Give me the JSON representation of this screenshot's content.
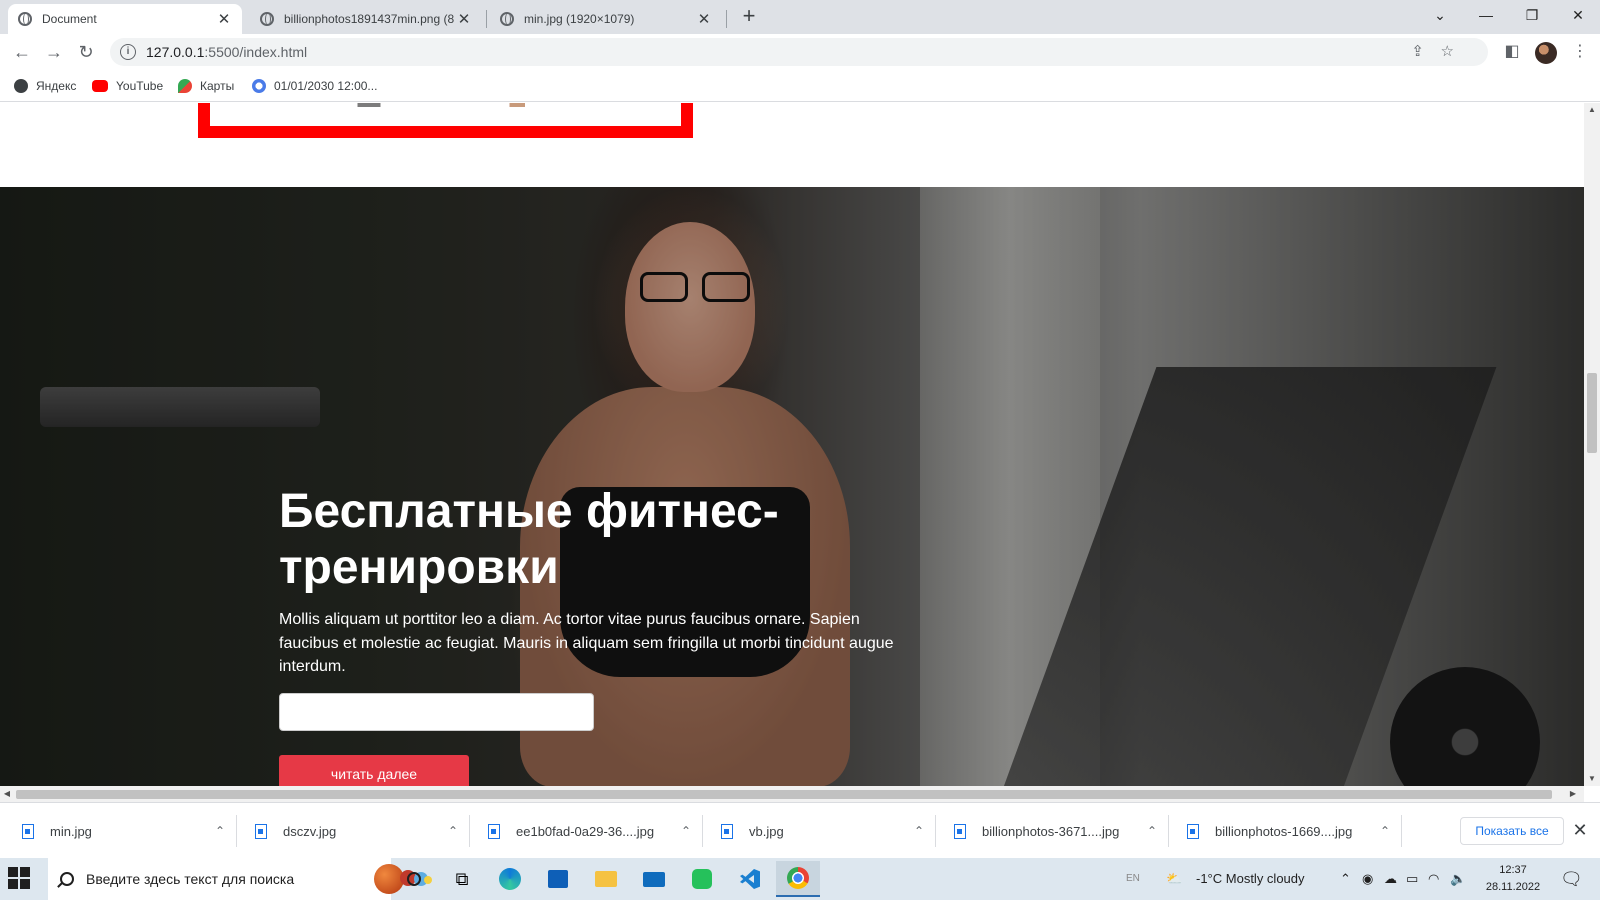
{
  "browser": {
    "tabs": [
      {
        "title": "Document",
        "active": true
      },
      {
        "title": "billionphotos1891437min.png (8",
        "active": false
      },
      {
        "title": "min.jpg (1920×1079)",
        "active": false
      }
    ],
    "new_tab_symbol": "+",
    "window_controls": {
      "dropdown": "⌄",
      "minimize": "—",
      "restore": "❐",
      "close": "✕"
    },
    "url": "127.0.0.1:5500/index.html",
    "url_host": "127.0.0.1",
    "url_path": ":5500/index.html",
    "bookmarks": [
      {
        "label": "Яндекс",
        "icon": "yandex-icon"
      },
      {
        "label": "YouTube",
        "icon": "youtube-icon"
      },
      {
        "label": "Карты",
        "icon": "maps-icon"
      },
      {
        "label": "01/01/2030 12:00...",
        "icon": "clock-icon"
      }
    ]
  },
  "page": {
    "hero": {
      "title": "Бесплатные фитнес-тренировки",
      "text": "Mollis aliquam ut porttitor leo a diam. Ac tortor vitae purus faucibus ornare. Sapien faucibus et molestie ac feugiat. Mauris in aliquam sem fringilla ut morbi tincidunt augue interdum.",
      "input_value": "",
      "button_label": "читать далее",
      "accent_color": "#e63946"
    }
  },
  "downloads": {
    "items": [
      {
        "name": "min.jpg"
      },
      {
        "name": "dsczv.jpg"
      },
      {
        "name": "ee1b0fad-0a29-36....jpg"
      },
      {
        "name": "vb.jpg"
      },
      {
        "name": "billionphotos-3671....jpg"
      },
      {
        "name": "billionphotos-1669....jpg"
      }
    ],
    "show_all_label": "Показать все",
    "close_symbol": "✕"
  },
  "taskbar": {
    "search_placeholder": "Введите здесь текст для поиска",
    "language": "EN",
    "weather": "-1°C  Mostly cloudy",
    "time": "12:37",
    "date": "28.11.2022"
  }
}
